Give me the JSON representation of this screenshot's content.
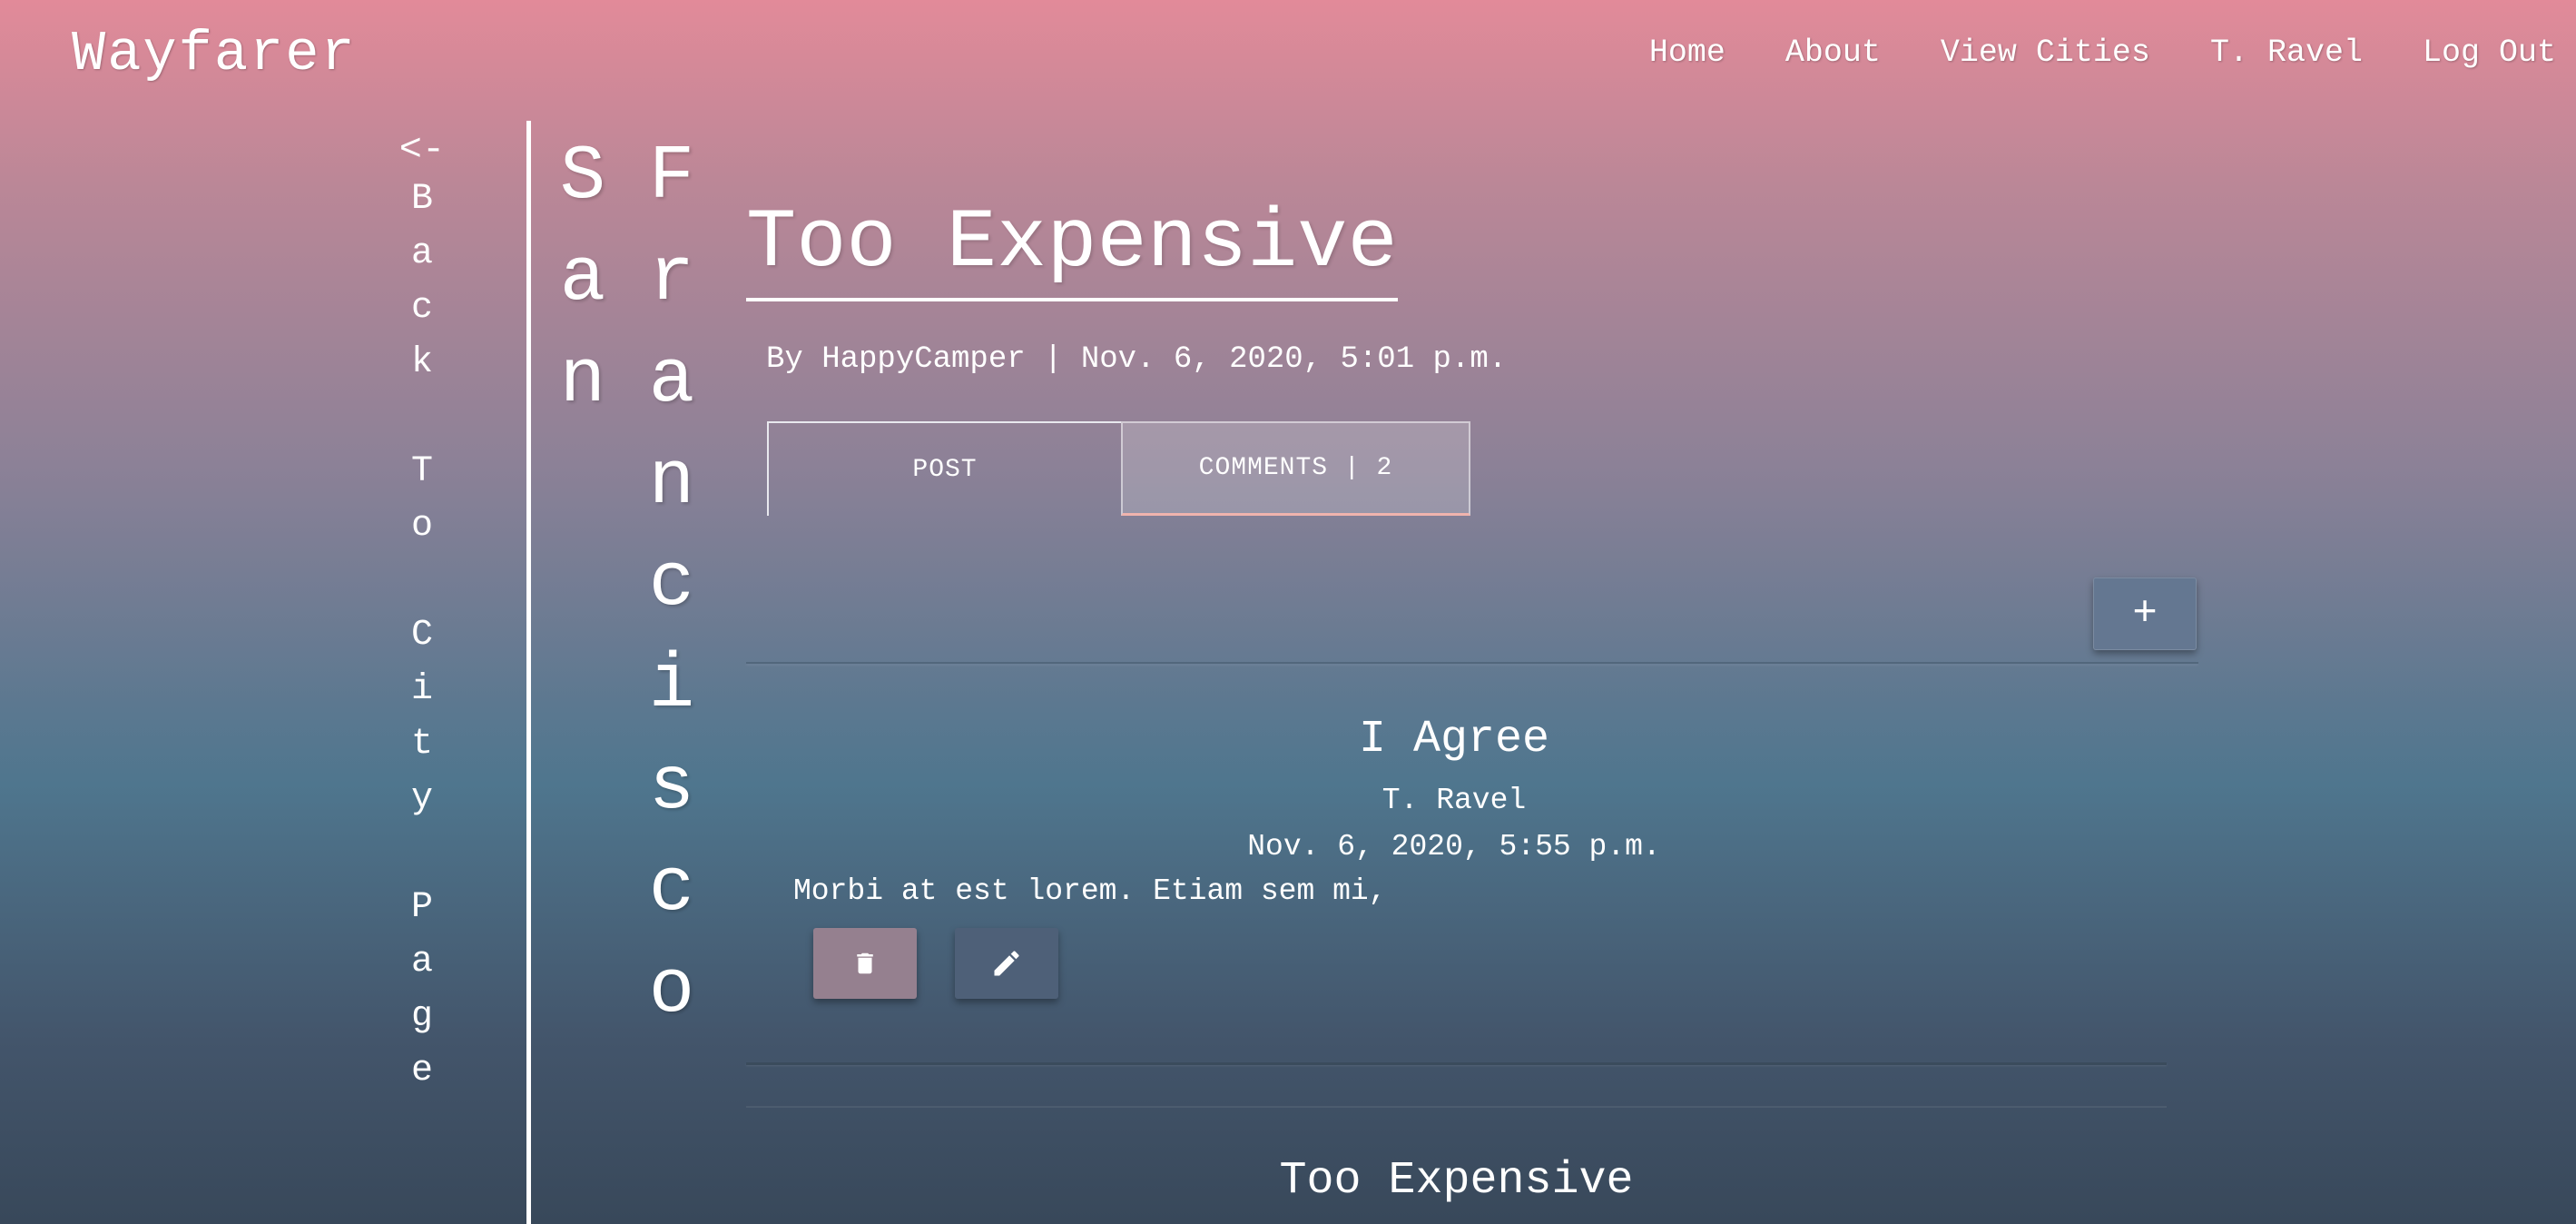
{
  "brand": "Wayfarer",
  "nav": [
    "Home",
    "About",
    "View Cities",
    "T. Ravel",
    "Log Out"
  ],
  "back": {
    "arrow": "<-",
    "text": "B\na\nc\nk\n\nT\no\n\nC\ni\nt\ny\n\nP\na\ng\ne"
  },
  "city": {
    "col1": [
      "S",
      "a",
      "n"
    ],
    "col2": [
      "F",
      "r",
      "a",
      "n",
      "c",
      "i",
      "s",
      "c",
      "o"
    ]
  },
  "post": {
    "title": "Too Expensive",
    "byline": "By HappyCamper | Nov. 6, 2020, 5:01 p.m."
  },
  "tabs": {
    "post": "POST",
    "comments": "COMMENTS | 2"
  },
  "add_label": "+",
  "comments": [
    {
      "title": "I Agree",
      "author": "T. Ravel",
      "date": "Nov. 6, 2020, 5:55 p.m.",
      "body": "Morbi at est lorem. Etiam sem mi,"
    },
    {
      "title": "Too Expensive"
    }
  ]
}
